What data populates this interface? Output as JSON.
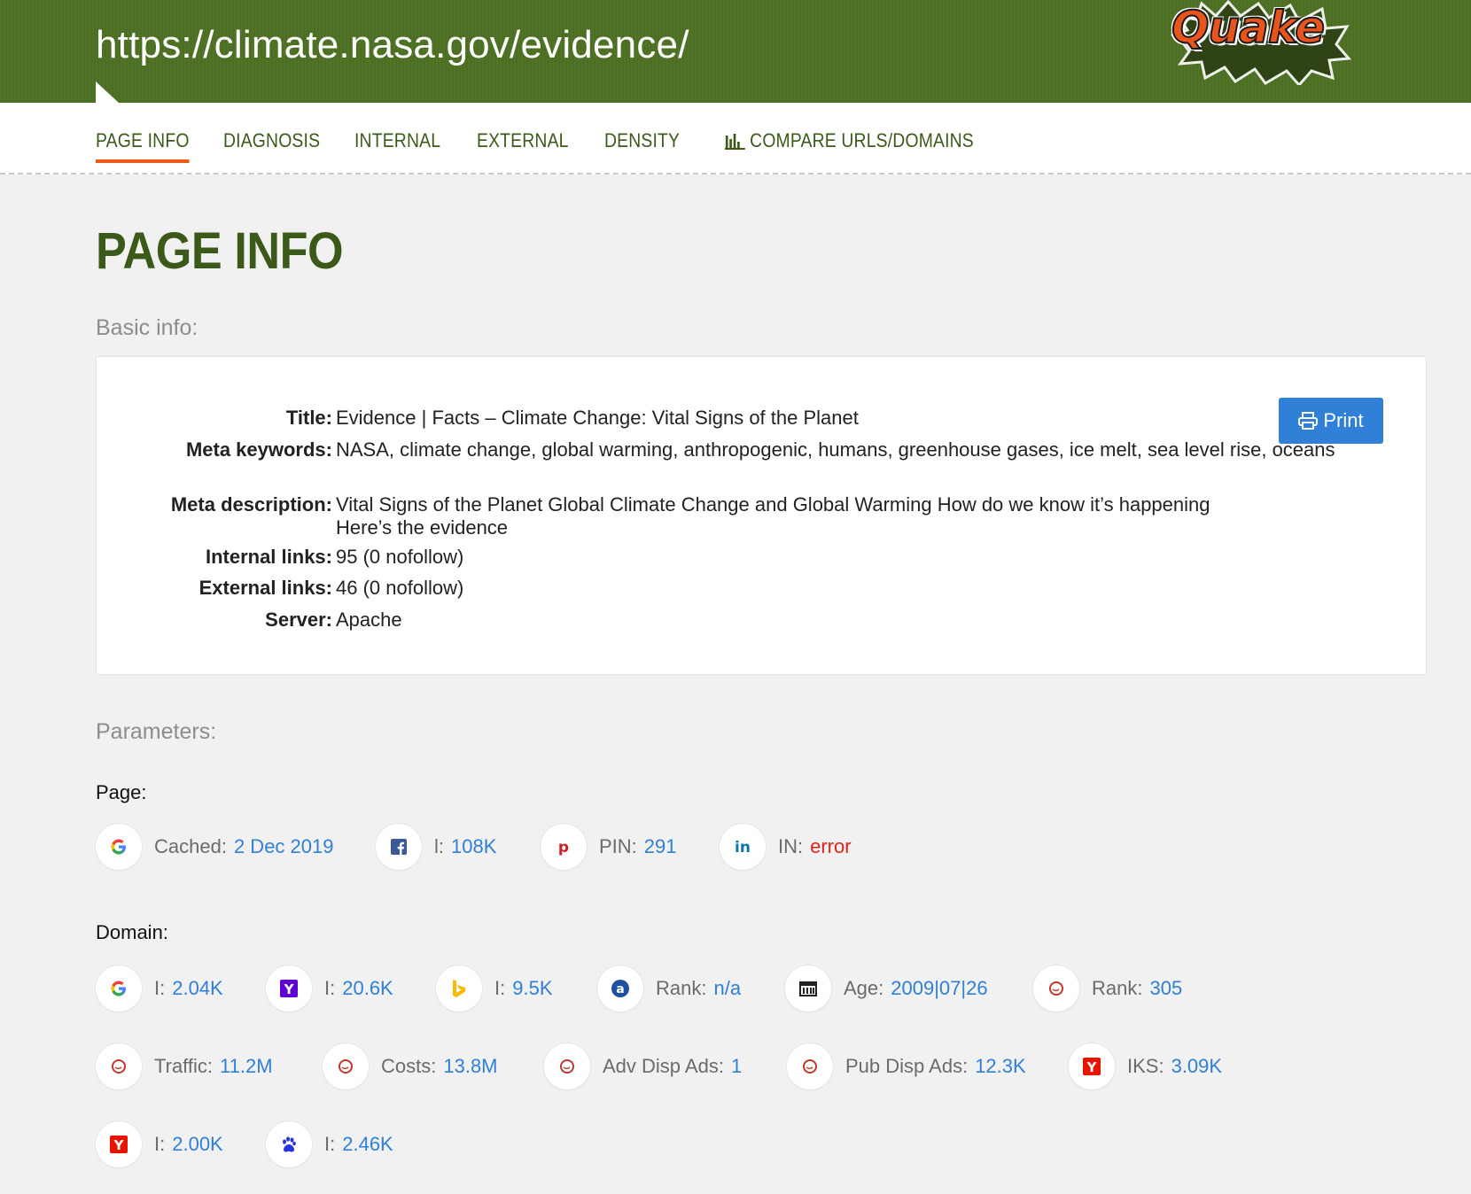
{
  "header": {
    "url": "https://climate.nasa.gov/evidence/",
    "logo_text": "Quake"
  },
  "tabs": [
    {
      "label": "PAGE INFO",
      "active": true
    },
    {
      "label": "DIAGNOSIS",
      "active": false
    },
    {
      "label": "INTERNAL",
      "active": false
    },
    {
      "label": "EXTERNAL",
      "active": false
    },
    {
      "label": "DENSITY",
      "active": false
    },
    {
      "label": "COMPARE URLS/DOMAINS",
      "active": false,
      "icon": "bar-chart-icon"
    }
  ],
  "page_title": "PAGE INFO",
  "basic_info": {
    "heading": "Basic info:",
    "rows": [
      {
        "key": "Title:",
        "value": "Evidence | Facts – Climate Change: Vital Signs of the Planet"
      },
      {
        "key": "Meta keywords:",
        "value": "NASA, climate change, global warming, anthropogenic, humans, greenhouse gases, ice melt, sea level rise, oceans"
      },
      {
        "key": "Meta description:",
        "value": "Vital Signs of the Planet Global Climate Change and Global Warming How do we know it’s happening Here’s the evidence"
      },
      {
        "key": "Internal links:",
        "value": "95 (0 nofollow)"
      },
      {
        "key": "External links:",
        "value": "46 (0 nofollow)"
      },
      {
        "key": "Server:",
        "value": "Apache"
      }
    ],
    "print_label": "Print"
  },
  "parameters": {
    "heading": "Parameters:",
    "page_label": "Page:",
    "page_metrics": [
      {
        "icon": "google-icon",
        "label": "Cached:",
        "value": "2 Dec 2019"
      },
      {
        "icon": "facebook-icon",
        "label": "l:",
        "value": "108K"
      },
      {
        "icon": "pinterest-icon",
        "label": "PIN:",
        "value": "291"
      },
      {
        "icon": "linkedin-icon",
        "label": "IN:",
        "value": "error"
      }
    ],
    "domain_label": "Domain:",
    "domain_metrics": [
      {
        "icon": "google-icon",
        "label": "I:",
        "value": "2.04K"
      },
      {
        "icon": "yahoo-icon",
        "label": "I:",
        "value": "20.6K"
      },
      {
        "icon": "bing-icon",
        "label": "I:",
        "value": "9.5K"
      },
      {
        "icon": "alexa-icon",
        "label": "Rank:",
        "value": "n/a"
      },
      {
        "icon": "calendar-icon",
        "label": "Age:",
        "value": "2009|07|26"
      },
      {
        "icon": "semrush-icon",
        "label": "Rank:",
        "value": "305"
      },
      {
        "icon": "semrush-icon",
        "label": "Traffic:",
        "value": "11.2M"
      },
      {
        "icon": "semrush-icon",
        "label": "Costs:",
        "value": "13.8M"
      },
      {
        "icon": "semrush-icon",
        "label": "Adv Disp Ads:",
        "value": "1"
      },
      {
        "icon": "semrush-icon",
        "label": "Pub Disp Ads:",
        "value": "12.3K"
      },
      {
        "icon": "yandex-icon",
        "label": "IKS:",
        "value": "3.09K"
      },
      {
        "icon": "yandex-icon",
        "label": "I:",
        "value": "2.00K"
      },
      {
        "icon": "baidu-icon",
        "label": "I:",
        "value": "2.46K"
      }
    ]
  },
  "colors": {
    "header_green": "#4b6e21",
    "tab_text": "#3b5a1a",
    "tab_active_underline": "#ef5a15",
    "link_blue": "#2f80d6",
    "error_red": "#e2231a",
    "print_button": "#2f80d6"
  }
}
